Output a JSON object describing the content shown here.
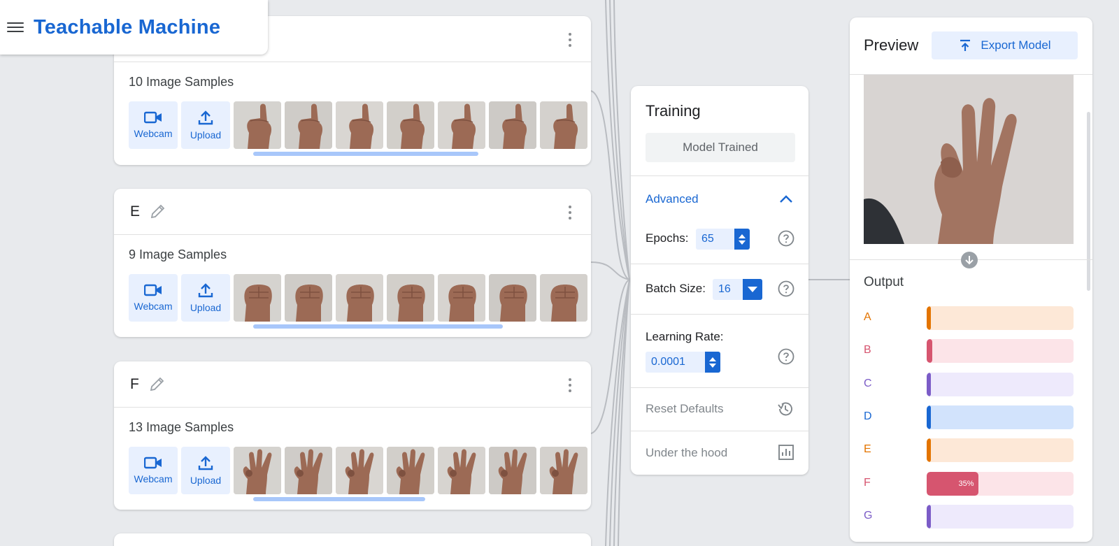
{
  "header": {
    "app_title": "Teachable Machine"
  },
  "classes": [
    {
      "name": "",
      "sample_count": "10 Image Samples",
      "webcam_label": "Webcam",
      "upload_label": "Upload",
      "pose": "index"
    },
    {
      "name": "E",
      "sample_count": "9 Image Samples",
      "webcam_label": "Webcam",
      "upload_label": "Upload",
      "pose": "fist"
    },
    {
      "name": "F",
      "sample_count": "13 Image Samples",
      "webcam_label": "Webcam",
      "upload_label": "Upload",
      "pose": "three"
    }
  ],
  "training": {
    "title": "Training",
    "model_button": "Model Trained",
    "advanced_label": "Advanced",
    "epochs_label": "Epochs:",
    "epochs_value": "65",
    "batch_label": "Batch Size:",
    "batch_value": "16",
    "lr_label": "Learning Rate:",
    "lr_value": "0.0001",
    "reset_label": "Reset Defaults",
    "hood_label": "Under the hood"
  },
  "preview": {
    "title": "Preview",
    "export_label": "Export Model",
    "output_title": "Output",
    "outputs": [
      {
        "label": "A",
        "value": 0.02,
        "color": "#e37400",
        "track": "#fde8d7",
        "text": ""
      },
      {
        "label": "B",
        "value": 0.04,
        "color": "#d6556f",
        "track": "#fce4e8",
        "text": ""
      },
      {
        "label": "C",
        "value": 0.01,
        "color": "#7b5cc7",
        "track": "#eeeafc",
        "text": ""
      },
      {
        "label": "D",
        "value": 0.02,
        "color": "#1967d2",
        "track": "#d2e3fc",
        "text": ""
      },
      {
        "label": "E",
        "value": 0.01,
        "color": "#e37400",
        "track": "#fde8d7",
        "text": ""
      },
      {
        "label": "F",
        "value": 0.35,
        "color": "#d6556f",
        "track": "#fce4e8",
        "text": "35%"
      },
      {
        "label": "G",
        "value": 0.0,
        "color": "#7b5cc7",
        "track": "#eeeafc",
        "text": ""
      }
    ]
  }
}
